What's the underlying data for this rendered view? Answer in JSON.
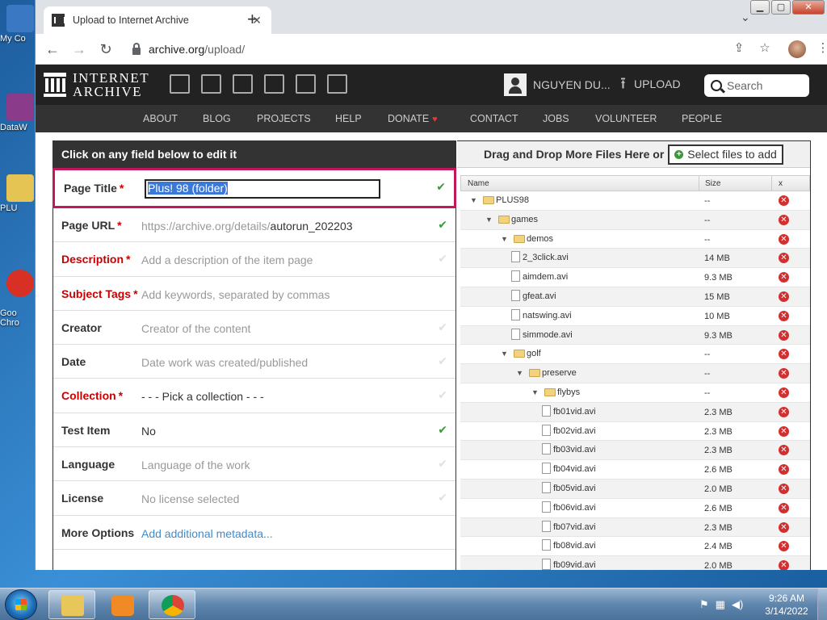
{
  "desktop": {
    "icons": [
      {
        "label": "My Co",
        "color": "#3a78c4"
      },
      {
        "label": "DataW",
        "color": "#8a3b8a"
      },
      {
        "label": "PLU",
        "color": "#e6c454"
      },
      {
        "label": "Goo\nChro",
        "color": "#d93025"
      }
    ]
  },
  "browser": {
    "tab_title": "Upload to Internet Archive",
    "tab_close": "✕",
    "new_tab": "+",
    "tab_dropdown": "⌄",
    "window_controls": {
      "minimize": "▁",
      "maximize": "▢",
      "close": "✕"
    },
    "nav": {
      "back": "←",
      "forward": "→",
      "reload": "↻"
    },
    "url_host": "archive.org",
    "url_path": "/upload/",
    "share_icon": "⇪",
    "star_icon": "☆",
    "menu_icon": "⋮"
  },
  "ia": {
    "logo_line1": "INTERNET",
    "logo_line2": "ARCHIVE",
    "user_name": "NGUYEN DU...",
    "upload_label": "UPLOAD",
    "upload_icon": "⭱",
    "search_placeholder": "Search",
    "nav": [
      "ABOUT",
      "BLOG",
      "PROJECTS",
      "HELP",
      "DONATE",
      "CONTACT",
      "JOBS",
      "VOLUNTEER",
      "PEOPLE"
    ],
    "donate_heart": "♥"
  },
  "meta": {
    "header": "Click on any field below to edit it",
    "required_star": "*",
    "check": "✔",
    "fields": {
      "page_title": {
        "label": "Page Title",
        "value": "Plus! 98 (folder)"
      },
      "page_url": {
        "label": "Page URL",
        "prefix": "https://archive.org/details/",
        "slug": "autorun_202203"
      },
      "description": {
        "label": "Description",
        "placeholder": "Add a description of the item page"
      },
      "subject_tags": {
        "label": "Subject Tags",
        "placeholder": "Add keywords, separated by commas"
      },
      "creator": {
        "label": "Creator",
        "placeholder": "Creator of the content"
      },
      "date": {
        "label": "Date",
        "placeholder": "Date work was created/published"
      },
      "collection": {
        "label": "Collection",
        "value": "- - - Pick a collection - - -"
      },
      "test_item": {
        "label": "Test Item",
        "value": "No"
      },
      "language": {
        "label": "Language",
        "placeholder": "Language of the work"
      },
      "license": {
        "label": "License",
        "placeholder": "No license selected"
      },
      "more_options": {
        "label": "More Options",
        "link": "Add additional metadata..."
      }
    }
  },
  "files": {
    "drag_text": "Drag and Drop More Files Here or",
    "select_btn": "Select files to add",
    "plus_icon": "+",
    "delete_icon": "✕",
    "columns": {
      "name": "Name",
      "size": "Size",
      "x": "x"
    },
    "rows": [
      {
        "name": "PLUS98",
        "size": "--",
        "type": "folder",
        "depth": 0
      },
      {
        "name": "games",
        "size": "--",
        "type": "folder",
        "depth": 1
      },
      {
        "name": "demos",
        "size": "--",
        "type": "folder",
        "depth": 2
      },
      {
        "name": "2_3click.avi",
        "size": "14 MB",
        "type": "file",
        "depth": 3
      },
      {
        "name": "aimdem.avi",
        "size": "9.3 MB",
        "type": "file",
        "depth": 3
      },
      {
        "name": "gfeat.avi",
        "size": "15 MB",
        "type": "file",
        "depth": 3
      },
      {
        "name": "natswing.avi",
        "size": "10 MB",
        "type": "file",
        "depth": 3
      },
      {
        "name": "simmode.avi",
        "size": "9.3 MB",
        "type": "file",
        "depth": 3
      },
      {
        "name": "golf",
        "size": "--",
        "type": "folder",
        "depth": 2
      },
      {
        "name": "preserve",
        "size": "--",
        "type": "folder",
        "depth": 3
      },
      {
        "name": "flybys",
        "size": "--",
        "type": "folder",
        "depth": 4
      },
      {
        "name": "fb01vid.avi",
        "size": "2.3 MB",
        "type": "file",
        "depth": 5
      },
      {
        "name": "fb02vid.avi",
        "size": "2.3 MB",
        "type": "file",
        "depth": 5
      },
      {
        "name": "fb03vid.avi",
        "size": "2.3 MB",
        "type": "file",
        "depth": 5
      },
      {
        "name": "fb04vid.avi",
        "size": "2.6 MB",
        "type": "file",
        "depth": 5
      },
      {
        "name": "fb05vid.avi",
        "size": "2.0 MB",
        "type": "file",
        "depth": 5
      },
      {
        "name": "fb06vid.avi",
        "size": "2.6 MB",
        "type": "file",
        "depth": 5
      },
      {
        "name": "fb07vid.avi",
        "size": "2.3 MB",
        "type": "file",
        "depth": 5
      },
      {
        "name": "fb08vid.avi",
        "size": "2.4 MB",
        "type": "file",
        "depth": 5
      },
      {
        "name": "fb09vid.avi",
        "size": "2.0 MB",
        "type": "file",
        "depth": 5
      }
    ]
  },
  "taskbar": {
    "time": "9:26 AM",
    "date": "3/14/2022",
    "tray_icons": [
      "flag-icon",
      "network-icon",
      "volume-icon"
    ]
  }
}
